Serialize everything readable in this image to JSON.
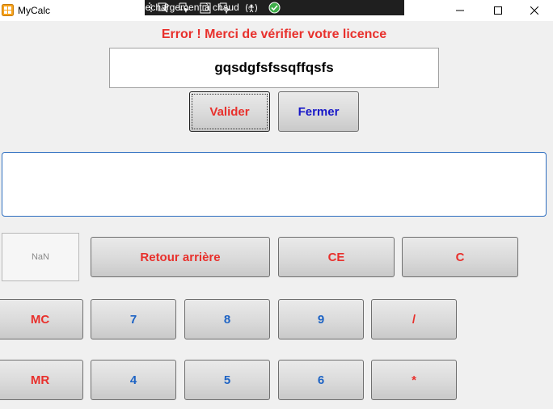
{
  "window": {
    "title": "MyCalc",
    "minimize_glyph": "—",
    "maximize_glyph": "☐",
    "close_glyph": "✕"
  },
  "debug_toolbar": {
    "hot_reload_label": "Rechargement à chaud",
    "chevron": "‹"
  },
  "license": {
    "error_message": "Error ! Merci de vérifier votre licence",
    "key_value": "gqsdgfsfssqffqsfs",
    "validate_label": "Valider",
    "close_label": "Fermer"
  },
  "calculator": {
    "display_value": "",
    "memory_value": "NaN",
    "buttons": {
      "backspace": "Retour arrière",
      "clear_entry": "CE",
      "clear": "C",
      "memory_clear": "MC",
      "memory_recall": "MR",
      "digit_7": "7",
      "digit_8": "8",
      "digit_9": "9",
      "digit_4": "4",
      "digit_5": "5",
      "digit_6": "6",
      "divide": "/",
      "multiply": "*"
    }
  },
  "colors": {
    "error_red": "#e8302c",
    "digit_blue": "#1d63c4",
    "close_navy": "#1818c8",
    "display_border": "#2f6fc0"
  }
}
